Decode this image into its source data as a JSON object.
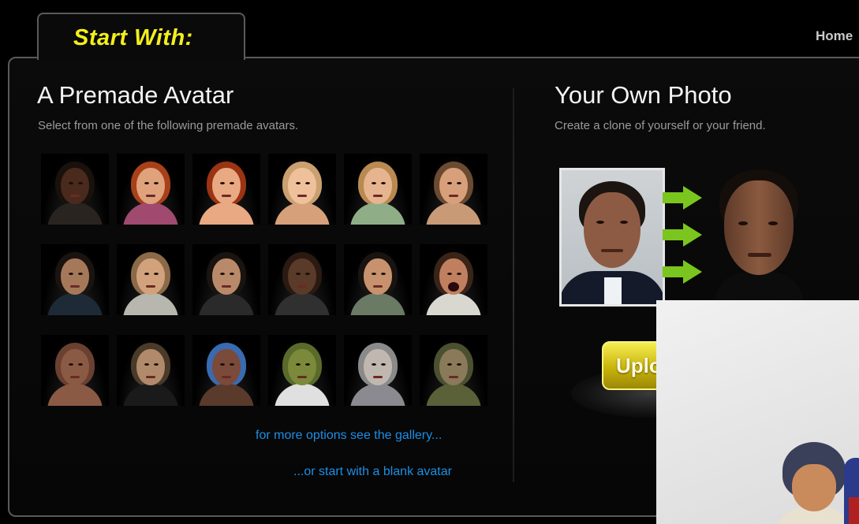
{
  "header": {
    "tab_label": "Start With:",
    "home_link": "Home"
  },
  "left_panel": {
    "title": "A Premade Avatar",
    "subtitle": "Select from one of the following premade avatars.",
    "more_options_link": "for more options see the gallery...",
    "blank_avatar_link": "...or start with a blank avatar"
  },
  "right_panel": {
    "title": "Your Own Photo",
    "subtitle": "Create a clone of yourself or your friend.",
    "upload_button_label": "Uplo"
  },
  "colors": {
    "accent_yellow": "#f3ef1b",
    "link_blue": "#1c8fe6",
    "arrow_green": "#7ac61e",
    "background": "#000000"
  },
  "avatars": [
    {
      "hair": "#1a110c",
      "skin": "#4a2a1c",
      "shirt": "#2a2420"
    },
    {
      "hair": "#a8401a",
      "skin": "#e0a27c",
      "shirt": "#a04a70"
    },
    {
      "hair": "#9a3412",
      "skin": "#e9a983",
      "shirt": "#e9a983"
    },
    {
      "hair": "#caa070",
      "skin": "#efc19a",
      "shirt": "#d6a07a"
    },
    {
      "hair": "#b88a52",
      "skin": "#e6b590",
      "shirt": "#8fae88"
    },
    {
      "hair": "#6a4a30",
      "skin": "#d7a07a",
      "shirt": "#c89a76"
    },
    {
      "hair": "#1a1410",
      "skin": "#a6785a",
      "shirt": "#1e2a36"
    },
    {
      "hair": "#8a6a48",
      "skin": "#d2a27c",
      "shirt": "#b7b7b0"
    },
    {
      "hair": "#1a1410",
      "skin": "#b98a6a",
      "shirt": "#2a2a2a"
    },
    {
      "hair": "#2a1a12",
      "skin": "#5a3a28",
      "shirt": "#303030"
    },
    {
      "hair": "#1a1410",
      "skin": "#c8926e",
      "shirt": "#6a7a64"
    },
    {
      "hair": "#3a2418",
      "skin": "#c08060",
      "shirt": "#d8d8d0",
      "open": true
    },
    {
      "hair": "#6a4030",
      "skin": "#8a5a44",
      "shirt": "#8a5a44"
    },
    {
      "hair": "#4a3a2a",
      "skin": "#b08a6a",
      "shirt": "#1a1a1a"
    },
    {
      "hair": "#3a6ab0",
      "skin": "#7a4a3a",
      "shirt": "#5a3a2a"
    },
    {
      "hair": "#5a6a2a",
      "skin": "#7a8a3a",
      "shirt": "#e0e0e0"
    },
    {
      "hair": "#8a8a8a",
      "skin": "#c0b8b0",
      "shirt": "#8a8a90"
    },
    {
      "hair": "#4a5030",
      "skin": "#8a7a5a",
      "shirt": "#5a6038"
    }
  ]
}
